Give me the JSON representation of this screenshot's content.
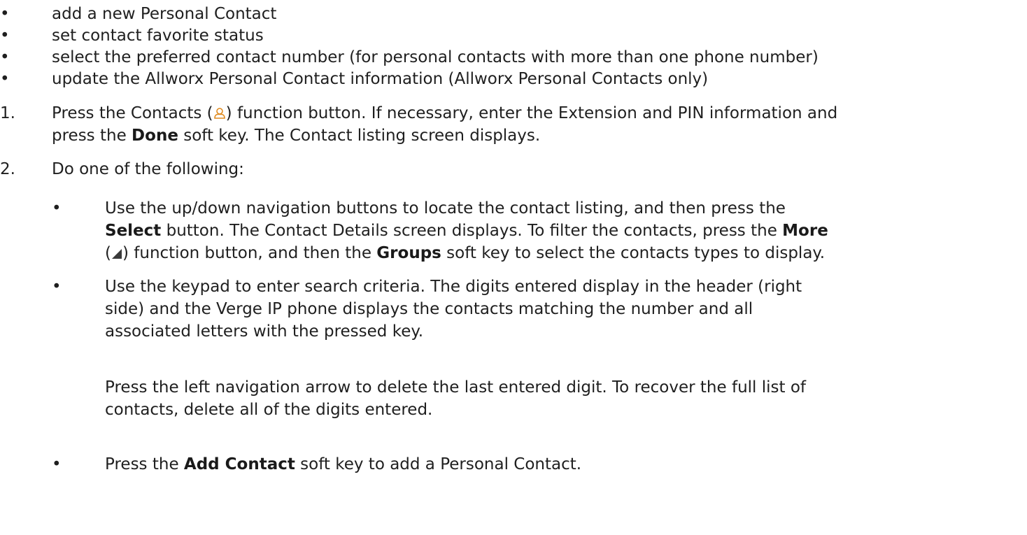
{
  "intro_bullets": [
    "add a new Personal Contact",
    "set contact favorite status",
    "select the preferred contact number (for personal contacts with more than one phone number)",
    "update the Allworx Personal Contact information (Allworx Personal Contacts only)"
  ],
  "bullet_glyph": "•",
  "step1": {
    "number": "1.",
    "line1_a": "Press the Contacts (",
    "icon": "contacts-person-icon",
    "line1_b": ") function button. If necessary, enter the Extension and PIN information and",
    "line2_a": "press the ",
    "line2_bold": "Done",
    "line2_b": " soft key. The Contact listing screen displays."
  },
  "step2": {
    "number": "2.",
    "text": "Do one of the following:",
    "sub_a": {
      "line1": "Use the up/down navigation buttons to locate the contact listing, and then press the",
      "line2_bold1": "Select",
      "line2_mid": " button. The Contact Details screen displays. To filter the contacts, press the ",
      "line2_bold2": "More",
      "line3_a": "(",
      "icon": "more-triangle-icon",
      "line3_b": ") function button, and then the ",
      "line3_bold": "Groups",
      "line3_c": " soft key to select the contacts types to display."
    },
    "sub_b": {
      "line1": "Use the keypad to enter search criteria. The digits entered display in the header (right",
      "line2": "side) and the Verge IP phone displays the contacts matching the number and all",
      "line3": "associated letters with the pressed key.",
      "para2_line1": "Press the left navigation arrow to delete the last entered digit. To recover the full list of",
      "para2_line2": "contacts, delete all of the digits entered."
    },
    "sub_c": {
      "a": "Press the ",
      "bold": "Add Contact",
      "b": " soft key to add a Personal Contact."
    }
  }
}
